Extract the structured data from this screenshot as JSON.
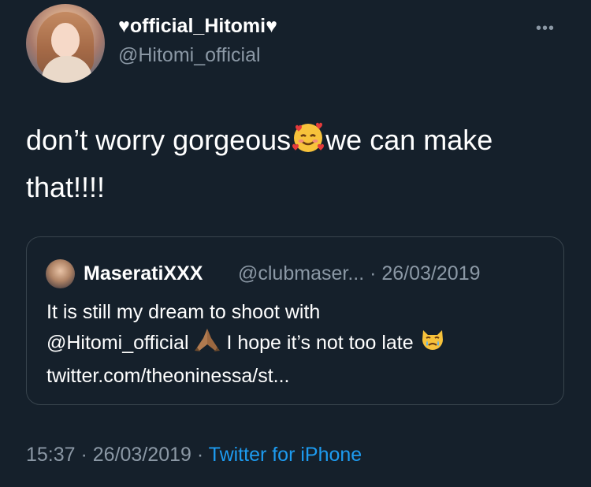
{
  "author": {
    "display_name": "♥official_Hitomi♥",
    "handle": "@Hitomi_official"
  },
  "menu": {
    "more_label": "•••"
  },
  "tweet": {
    "text_part1": "don’t worry gorgeous",
    "text_part2": "we can make that!!!!",
    "emoji_icon": "smiling-face-with-hearts-icon"
  },
  "quoted_tweet": {
    "display_name": "MaseratiXXX",
    "handle_and_date": "@clubmaser... · 26/03/2019",
    "text_line1": "It is still my dream to shoot with",
    "text_mention": "@Hitomi_official",
    "text_after_mention": "I hope it’s not too late",
    "text_link": "twitter.com/theoninessa/st...",
    "emoji_icons": [
      "folded-hands-icon",
      "crying-cat-face-icon"
    ]
  },
  "footer": {
    "time_and_date": "15:37 · 26/03/2019 · ",
    "source": "Twitter for iPhone"
  },
  "colors": {
    "background": "#15202b",
    "secondary_text": "#8b98a5",
    "link_blue": "#1d9bf0",
    "border": "#38444d"
  }
}
